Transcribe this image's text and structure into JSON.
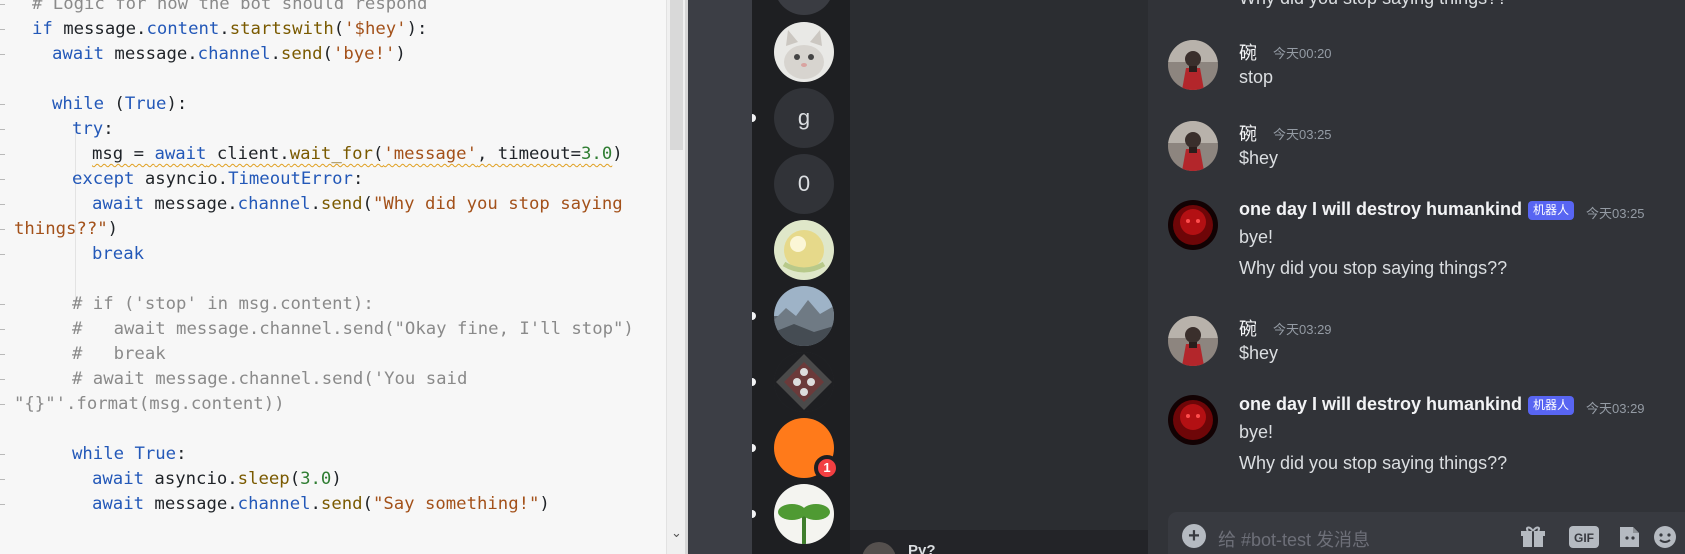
{
  "editor": {
    "lines": [
      [
        {
          "t": "# Logic for how the bot should respond",
          "c": "cm"
        }
      ],
      [
        {
          "t": "if",
          "c": "kw"
        },
        {
          "t": " message."
        },
        {
          "t": "content",
          "c": "kw"
        },
        {
          "t": "."
        },
        {
          "t": "startswith",
          "c": "fn"
        },
        {
          "t": "("
        },
        {
          "t": "'$hey'",
          "c": "st"
        },
        {
          "t": "):"
        }
      ],
      [
        {
          "t": "await",
          "c": "kw"
        },
        {
          "t": " message."
        },
        {
          "t": "channel",
          "c": "kw"
        },
        {
          "t": "."
        },
        {
          "t": "send",
          "c": "fn"
        },
        {
          "t": "("
        },
        {
          "t": "'bye!'",
          "c": "st"
        },
        {
          "t": ")"
        }
      ],
      [],
      [
        {
          "t": "while",
          "c": "kw"
        },
        {
          "t": " ("
        },
        {
          "t": "True",
          "c": "kw"
        },
        {
          "t": "):"
        }
      ],
      [
        {
          "t": "try",
          "c": "kw"
        },
        {
          "t": ":"
        }
      ],
      [
        {
          "t": "msg = ",
          "sq": true
        },
        {
          "t": "await",
          "c": "kw",
          "sq": true
        },
        {
          "t": " client.",
          "sq": true
        },
        {
          "t": "wait_for",
          "c": "fn",
          "sq": true
        },
        {
          "t": "(",
          "sq": true
        },
        {
          "t": "'message'",
          "c": "st",
          "sq": true
        },
        {
          "t": ", timeout=",
          "sq": true
        },
        {
          "t": "3.0",
          "c": "nu",
          "sq": true
        },
        {
          "t": ")"
        }
      ],
      [
        {
          "t": "except",
          "c": "kw"
        },
        {
          "t": " asyncio."
        },
        {
          "t": "TimeoutError",
          "c": "kw"
        },
        {
          "t": ":"
        }
      ],
      [
        {
          "t": "await",
          "c": "kw"
        },
        {
          "t": " message."
        },
        {
          "t": "channel",
          "c": "kw"
        },
        {
          "t": "."
        },
        {
          "t": "send",
          "c": "fn"
        },
        {
          "t": "("
        },
        {
          "t": "\"Why did you stop saying",
          "c": "st"
        }
      ],
      [
        {
          "t": "things??\"",
          "c": "st"
        },
        {
          "t": ")"
        }
      ],
      [
        {
          "t": "break",
          "c": "kw"
        }
      ],
      [],
      [
        {
          "t": "# if ('stop' in msg.content):",
          "c": "cm"
        }
      ],
      [
        {
          "t": "#   await message.channel.send(\"Okay fine, I'll stop\")",
          "c": "cm"
        }
      ],
      [
        {
          "t": "#   break",
          "c": "cm"
        }
      ],
      [
        {
          "t": "# await message.channel.send('You said",
          "c": "cm"
        }
      ],
      [
        {
          "t": "\"{}\"'.format(msg.content))",
          "c": "cm"
        }
      ],
      [],
      [
        {
          "t": "while",
          "c": "kw"
        },
        {
          "t": " "
        },
        {
          "t": "True",
          "c": "kw"
        },
        {
          "t": ":"
        }
      ],
      [
        {
          "t": "await",
          "c": "kw"
        },
        {
          "t": " asyncio."
        },
        {
          "t": "sleep",
          "c": "fn"
        },
        {
          "t": "("
        },
        {
          "t": "3.0",
          "c": "nu"
        },
        {
          "t": ")"
        }
      ],
      [
        {
          "t": "await",
          "c": "kw"
        },
        {
          "t": " message."
        },
        {
          "t": "channel",
          "c": "kw"
        },
        {
          "t": "."
        },
        {
          "t": "send",
          "c": "fn"
        },
        {
          "t": "("
        },
        {
          "t": "\"Say something!\"",
          "c": "st"
        },
        {
          "t": ")"
        }
      ]
    ],
    "scroll_down_glyph": "⌄"
  },
  "servers": [
    {
      "label": "",
      "kind": "dark"
    },
    {
      "label": "",
      "kind": "cat"
    },
    {
      "label": "g",
      "kind": "text"
    },
    {
      "label": "0",
      "kind": "text"
    },
    {
      "label": "",
      "kind": "orb"
    },
    {
      "label": "",
      "kind": "landscape"
    },
    {
      "label": "",
      "kind": "skulls"
    },
    {
      "label": "",
      "kind": "orange",
      "badge": "1"
    },
    {
      "label": "",
      "kind": "sprout"
    }
  ],
  "user": {
    "name": "Ру?"
  },
  "chat": {
    "bot_tag": "机器人",
    "previous_tail": "Why did you stop saying things??",
    "messages": [
      {
        "author": "碗",
        "time": "今天00:20",
        "bot": false,
        "lines": [
          "stop"
        ]
      },
      {
        "author": "碗",
        "time": "今天03:25",
        "bot": false,
        "lines": [
          "$hey"
        ]
      },
      {
        "author": "one day I will destroy humankind",
        "time": "今天03:25",
        "bot": true,
        "lines": [
          "bye!",
          "Why did you stop saying things??"
        ]
      },
      {
        "author": "碗",
        "time": "今天03:29",
        "bot": false,
        "lines": [
          "$hey"
        ]
      },
      {
        "author": "one day I will destroy humankind",
        "time": "今天03:29",
        "bot": true,
        "lines": [
          "bye!",
          "Why did you stop saying things??"
        ]
      }
    ],
    "composer_placeholder": "给 #bot-test 发消息",
    "composer_icons": [
      "plus-icon",
      "gift-icon",
      "gif-icon",
      "sticker-icon",
      "emoji-icon"
    ],
    "gif_label": "GIF"
  }
}
